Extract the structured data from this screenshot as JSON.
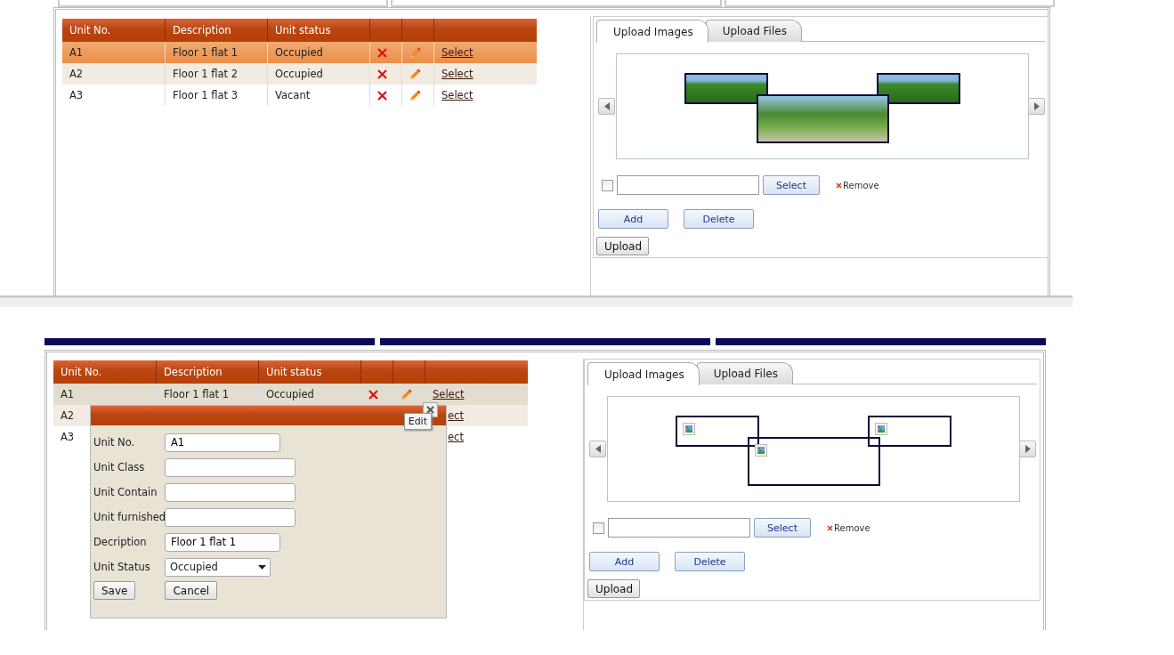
{
  "screens": [
    {
      "table": {
        "columns": [
          "Unit No.",
          "Description",
          "Unit status"
        ],
        "rows": [
          {
            "unit": "A1",
            "description": "Floor 1 flat 1",
            "status": "Occupied",
            "link": "Select",
            "selected": true,
            "hover": false
          },
          {
            "unit": "A2",
            "description": "Floor 1 flat 2",
            "status": "Occupied",
            "link": "Select",
            "selected": false,
            "hover": false
          },
          {
            "unit": "A3",
            "description": "Floor 1 flat 3",
            "status": "Vacant",
            "link": "Select",
            "selected": false,
            "hover": false
          }
        ]
      },
      "upload": {
        "tabs": [
          {
            "label": "Upload Images",
            "selected": true
          },
          {
            "label": "Upload Files",
            "selected": false
          }
        ],
        "carousel": {
          "kind": "photos"
        },
        "checkbox": {
          "checked": false
        },
        "select_button": "Select",
        "remove_link": "Remove",
        "add_button": "Add",
        "delete_button": "Delete",
        "upload_button": "Upload"
      }
    },
    {
      "table": {
        "columns": [
          "Unit No.",
          "Description",
          "Unit status"
        ],
        "rows": [
          {
            "unit": "A1",
            "description": "Floor 1 flat 1",
            "status": "Occupied",
            "link": "Select",
            "selected": false,
            "hover": true,
            "covered": false
          },
          {
            "unit": "A2",
            "link": "ect",
            "selected": false,
            "hover": false,
            "covered": true
          },
          {
            "unit": "A3",
            "link": "ect",
            "selected": false,
            "hover": false,
            "covered": true
          }
        ]
      },
      "upload": {
        "tabs": [
          {
            "label": "Upload Images",
            "selected": true
          },
          {
            "label": "Upload Files",
            "selected": false
          }
        ],
        "carousel": {
          "kind": "broken"
        },
        "checkbox": {
          "checked": false
        },
        "select_button": "Select",
        "remove_link": "Remove",
        "add_button": "Add",
        "delete_button": "Delete",
        "upload_button": "Upload"
      },
      "dialog": {
        "tooltip": "Edit",
        "fields": [
          {
            "label": "Unit No.",
            "value": "A1",
            "kind": "short"
          },
          {
            "label": "Unit Class",
            "kind": "long"
          },
          {
            "label": "Unit Contain",
            "kind": "long"
          },
          {
            "label": "Unit furnished",
            "kind": "long"
          },
          {
            "label": "Decription",
            "value": "Floor 1 flat 1",
            "kind": "short"
          },
          {
            "label": "Unit Status",
            "value": "Occupied",
            "kind": "dropdown"
          }
        ],
        "buttons": [
          "Save",
          "Cancel"
        ]
      }
    }
  ]
}
